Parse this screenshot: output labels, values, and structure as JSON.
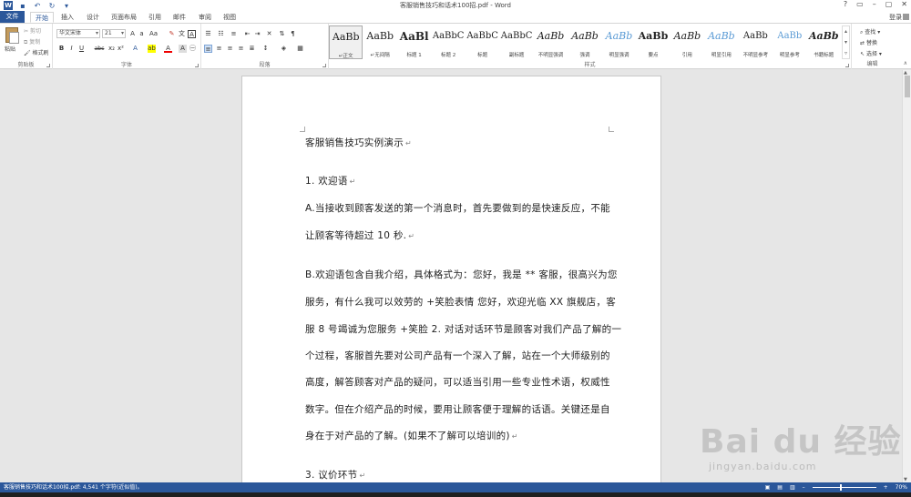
{
  "window": {
    "title": "客服销售技巧和话术100招.pdf - Word",
    "controls": [
      "?",
      "▭",
      "–",
      "▢",
      "✕"
    ],
    "login": "登录"
  },
  "quick_access": {
    "logo": "W"
  },
  "tabs": [
    {
      "label": "文件"
    },
    {
      "label": "开始"
    },
    {
      "label": "插入"
    },
    {
      "label": "设计"
    },
    {
      "label": "页面布局"
    },
    {
      "label": "引用"
    },
    {
      "label": "邮件"
    },
    {
      "label": "审阅"
    },
    {
      "label": "视图"
    }
  ],
  "ribbon": {
    "clipboard": {
      "label": "剪贴板",
      "paste": "粘贴",
      "cut": "剪切",
      "copy": "复制",
      "format_painter": "格式刷"
    },
    "font": {
      "label": "字体",
      "font_name": "华文宋体",
      "font_size": "21",
      "buttons": [
        "B",
        "I",
        "U",
        "abc",
        "x₂",
        "x²"
      ]
    },
    "paragraph": {
      "label": "段落"
    },
    "styles": {
      "label": "样式",
      "items": [
        {
          "sample": "AaBb",
          "name": "↵正文"
        },
        {
          "sample": "AaBb",
          "name": "↵无间隔"
        },
        {
          "sample": "AaBl",
          "name": "标题 1"
        },
        {
          "sample": "AaBbC",
          "name": "标题 2"
        },
        {
          "sample": "AaBbC",
          "name": "标题"
        },
        {
          "sample": "AaBbC",
          "name": "副标题"
        },
        {
          "sample": "AaBb",
          "name": "不明显强调"
        },
        {
          "sample": "AaBb",
          "name": "强调"
        },
        {
          "sample": "AaBb",
          "name": "明显强调"
        },
        {
          "sample": "AaBb",
          "name": "要点"
        },
        {
          "sample": "AaBb",
          "name": "引用"
        },
        {
          "sample": "AaBb",
          "name": "明显引用"
        },
        {
          "sample": "AaBb",
          "name": "不明显参考"
        },
        {
          "sample": "AaBb",
          "name": "明显参考"
        },
        {
          "sample": "AaBb",
          "name": "书籍标题"
        }
      ]
    },
    "editing": {
      "label": "编辑",
      "find": "查找",
      "replace": "替换",
      "select": "选择"
    }
  },
  "document": {
    "lines": [
      "客服销售技巧实例演示",
      "1. 欢迎语",
      "A.当接收到顾客发送的第一个消息时，首先要做到的是快速反应，不能",
      "让顾客等待超过 10 秒.",
      "B.欢迎语包含自我介绍，具体格式为：您好，我是 ** 客服，很高兴为您",
      "服务，有什么我可以效劳的 +笑脸表情 您好，欢迎光临 XX 旗舰店，客",
      "服 8 号竭诚为您服务 +笑脸 2. 对话对话环节是顾客对我们产品了解的一",
      "个过程，客服首先要对公司产品有一个深入了解，站在一个大师级别的",
      "高度，解答顾客对产品的疑问，可以适当引用一些专业性术语，权威性",
      "数字。但在介绍产品的时候，要用让顾客便于理解的话语。关键还是自",
      "身在于对产品的了解。(如果不了解可以培训的)",
      "3. 议价环节"
    ],
    "para_mark": "↵"
  },
  "statusbar": {
    "left": "客服销售技巧和话术100招.pdf: 4,541 个字符(近似值)。",
    "zoom": "70%"
  },
  "watermark": {
    "logo_text": "Bai du 经验",
    "url": "jingyan.baidu.com"
  }
}
